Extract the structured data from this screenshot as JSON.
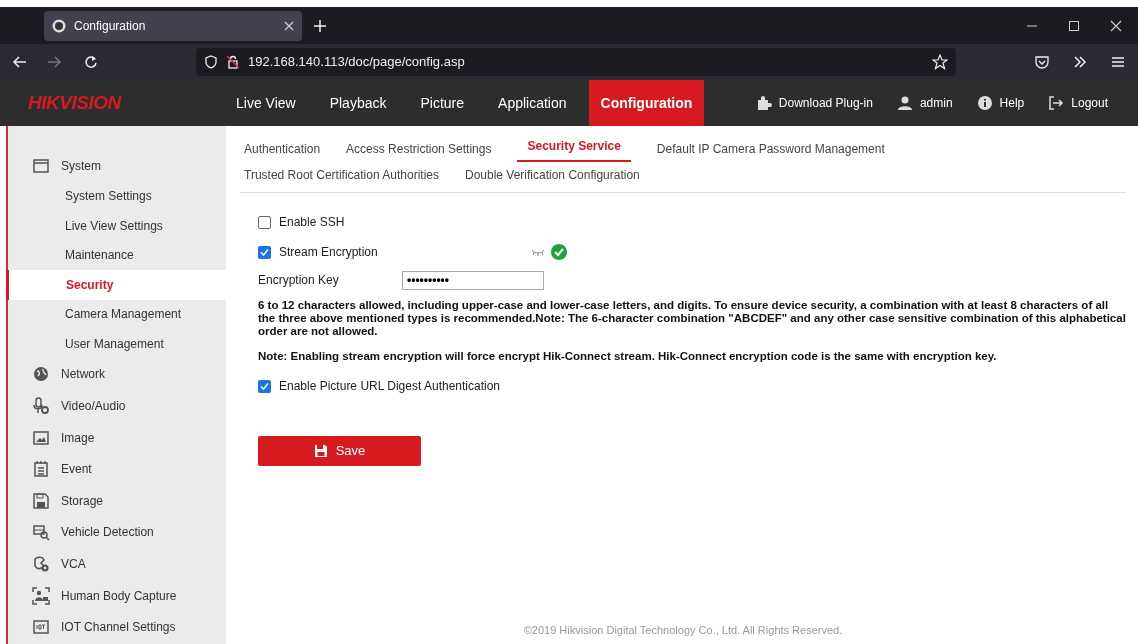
{
  "browser": {
    "tab": {
      "title": "Configuration"
    },
    "address": "192.168.140.113/doc/page/config.asp"
  },
  "header": {
    "logo": "HIKVISION",
    "nav": [
      {
        "label": "Live View",
        "selected": false
      },
      {
        "label": "Playback",
        "selected": false
      },
      {
        "label": "Picture",
        "selected": false
      },
      {
        "label": "Application",
        "selected": false
      },
      {
        "label": "Configuration",
        "selected": true
      }
    ],
    "actions": [
      {
        "kind": "plugin",
        "label": "Download Plug-in"
      },
      {
        "kind": "user",
        "label": "admin"
      },
      {
        "kind": "help",
        "label": "Help"
      },
      {
        "kind": "logout",
        "label": "Logout"
      }
    ]
  },
  "sidebar": {
    "items": [
      {
        "kind": "system",
        "label": "System",
        "selected": false,
        "children": [
          {
            "label": "System Settings",
            "selected": false
          },
          {
            "label": "Live View Settings",
            "selected": false
          },
          {
            "label": "Maintenance",
            "selected": false
          },
          {
            "label": "Security",
            "selected": true
          },
          {
            "label": "Camera Management",
            "selected": false
          },
          {
            "label": "User Management",
            "selected": false
          }
        ]
      },
      {
        "kind": "network",
        "label": "Network",
        "selected": false
      },
      {
        "kind": "video",
        "label": "Video/Audio",
        "selected": false
      },
      {
        "kind": "image",
        "label": "Image",
        "selected": false
      },
      {
        "kind": "event",
        "label": "Event",
        "selected": false
      },
      {
        "kind": "storage",
        "label": "Storage",
        "selected": false
      },
      {
        "kind": "vehicle",
        "label": "Vehicle Detection",
        "selected": false
      },
      {
        "kind": "vca",
        "label": "VCA",
        "selected": false
      },
      {
        "kind": "body",
        "label": "Human Body Capture",
        "selected": false
      },
      {
        "kind": "iot",
        "label": "IOT Channel Settings",
        "selected": false
      }
    ]
  },
  "tabs": [
    {
      "label": "Authentication",
      "selected": false
    },
    {
      "label": "Access Restriction Settings",
      "selected": false
    },
    {
      "label": "Security Service",
      "selected": true
    },
    {
      "label": "Default IP Camera Password Management",
      "selected": false
    },
    {
      "label": "Trusted Root Certification Authorities",
      "selected": false
    },
    {
      "label": "Double Verification Configuration",
      "selected": false
    }
  ],
  "form": {
    "enable_ssh": {
      "label": "Enable SSH",
      "checked": false
    },
    "stream_encryption": {
      "label": "Stream Encryption",
      "checked": true,
      "valid": true
    },
    "encryption_key": {
      "label": "Encryption Key",
      "value": "••••••••••"
    },
    "notes": [
      "6 to 12 characters allowed, including upper-case and lower-case letters, and digits. To ensure device security, a combination with at least 8 characters of all the three above mentioned types is recommended.Note: The 6-character combination \"ABCDEF\" and any other case sensitive combination of this alphabetical order are not allowed.",
      "Note: Enabling stream encryption will force encrypt Hik-Connect stream. Hik-Connect encryption code is the same with encryption key."
    ],
    "picture_url_auth": {
      "label": "Enable Picture URL Digest Authentication",
      "checked": true
    },
    "save": "Save"
  },
  "footer": "©2019 Hikvision Digital Technology Co., Ltd. All Rights Reserved."
}
